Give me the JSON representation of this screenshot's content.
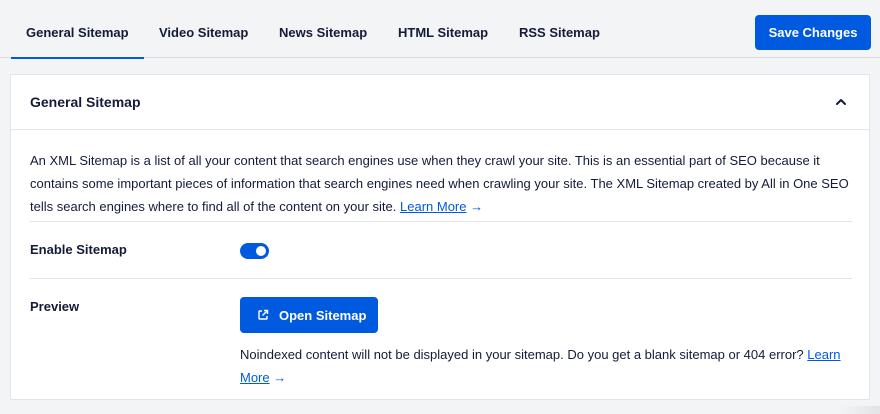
{
  "tabs": [
    {
      "label": "General Sitemap",
      "active": true
    },
    {
      "label": "Video Sitemap",
      "active": false
    },
    {
      "label": "News Sitemap",
      "active": false
    },
    {
      "label": "HTML Sitemap",
      "active": false
    },
    {
      "label": "RSS Sitemap",
      "active": false
    }
  ],
  "header": {
    "save_label": "Save Changes"
  },
  "card": {
    "title": "General Sitemap",
    "collapse_icon": "chevron-up-icon",
    "description": "An XML Sitemap is a list of all your content that search engines use when they crawl your site. This is an essential part of SEO because it contains some important pieces of information that search engines need when crawling your site. The XML Sitemap created by All in One SEO tells search engines where to find all of the content on your site.",
    "learn_more": "Learn More",
    "arrow": "→"
  },
  "enable_sitemap": {
    "label": "Enable Sitemap",
    "enabled": true
  },
  "preview": {
    "label": "Preview",
    "open_button": "Open Sitemap",
    "open_icon": "external-link-icon",
    "note": "Noindexed content will not be displayed in your sitemap. Do you get a blank sitemap or 404 error?",
    "learn_more": "Learn More"
  },
  "colors": {
    "accent": "#005ae0",
    "text": "#141b38",
    "background": "#f3f4f5"
  }
}
